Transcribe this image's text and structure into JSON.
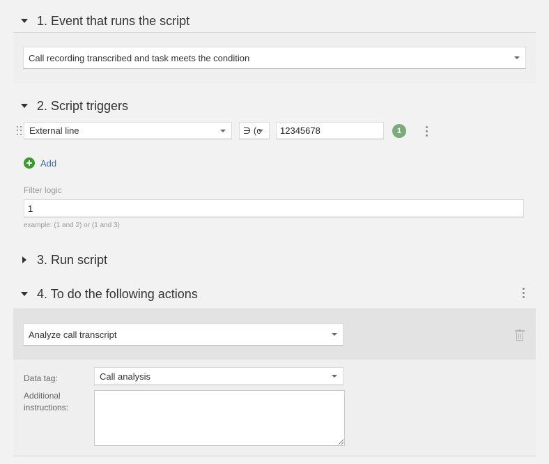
{
  "sections": {
    "event": {
      "title": "1. Event that runs the script",
      "selected": "Call recording transcribed and task meets the condition"
    },
    "triggers": {
      "title": "2. Script triggers",
      "condition_field": "External line",
      "operator": "∋ (c",
      "value": "12345678",
      "badge": "1",
      "add_label": "Add",
      "filter_logic_label": "Filter logic",
      "filter_logic_value": "1",
      "filter_logic_hint": "example: (1 and 2) or (1 and 3)"
    },
    "run": {
      "title": "3. Run script"
    },
    "actions": {
      "title": "4. To do the following actions",
      "action_selected": "Analyze call transcript",
      "data_tag_label": "Data tag:",
      "data_tag_value": "Call analysis",
      "instructions_label": "Additional instructions:",
      "instructions_value": ""
    }
  },
  "colors": {
    "badge": "#7aab7a",
    "add_icon": "#3a9a2a",
    "link": "#3b6ea8"
  }
}
